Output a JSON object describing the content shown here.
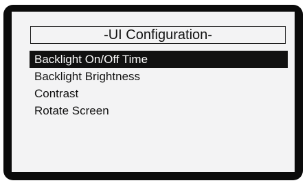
{
  "screen": {
    "title": "-UI Configuration-"
  },
  "menu": {
    "selected_index": 0,
    "items": [
      {
        "label": "Backlight On/Off Time"
      },
      {
        "label": "Backlight Brightness"
      },
      {
        "label": "Contrast"
      },
      {
        "label": "Rotate Screen"
      }
    ]
  },
  "colors": {
    "bezel": "#0b0b0b",
    "screen_background": "#f3f3f4",
    "text": "#111111",
    "selection_background": "#111111",
    "selection_text": "#ffffff"
  }
}
